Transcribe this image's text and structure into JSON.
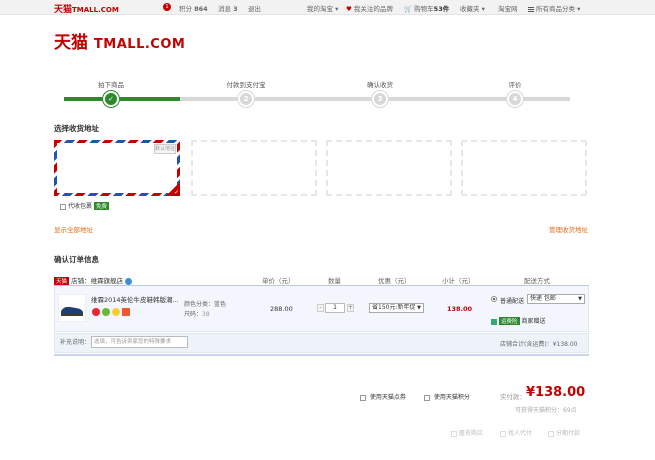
{
  "topbar": {
    "brand_cn": "天猫",
    "brand_en": "TMALL.COM",
    "notice_count": "1",
    "points_label": "积分",
    "points_value": "864",
    "messages_label": "消息",
    "messages_value": "3",
    "logout": "退出",
    "my_taobao": "我的淘宝",
    "followed_brands": "我关注的品牌",
    "cart_label": "购物车",
    "cart_count": "53件",
    "favorites": "收藏夹",
    "taobao_net": "淘宝网",
    "all_categories": "所有商品分类"
  },
  "logo": {
    "cn": "天猫",
    "en": "TMALL.COM"
  },
  "steps": [
    {
      "label": "拍下商品",
      "num": "✓",
      "done": true
    },
    {
      "label": "付款到支付宝",
      "num": "2",
      "done": false
    },
    {
      "label": "确认收货",
      "num": "3",
      "done": false
    },
    {
      "label": "评价",
      "num": "4",
      "done": false
    }
  ],
  "address": {
    "title": "选择收货地址",
    "stamp": "默认地址",
    "cod_label": "代收包裹",
    "cod_tag": "免费",
    "show_all": "显示全部地址",
    "manage": "管理收货地址"
  },
  "order": {
    "title": "确认订单信息",
    "shop_badge": "天猫",
    "shop_label": "店铺：",
    "shop_name": "维霖旗舰店",
    "col_price": "单价（元）",
    "col_qty": "数量",
    "col_discount": "优惠（元）",
    "col_subtotal": "小计（元）",
    "col_shipping": "配送方式",
    "item_title": "维霖2014英伦牛皮鞋韩版潮...",
    "attr_color": "颜色分类：蓝色",
    "attr_size_label": "尺码：",
    "attr_size_value": "38",
    "price": "288.00",
    "qty": "1",
    "discount_option": "省150元:新年促",
    "subtotal": "138.00",
    "ship_normal": "普通配送",
    "ship_option": "快递 包邮",
    "ship_tag": "运费险",
    "ship_merchant": "商家赠送",
    "remark_label": "补充说明：",
    "remark_placeholder": "选填，可告诉卖家您的特殊要求",
    "shop_total_label": "店铺合计(含运费)：",
    "shop_total_value": "¥138.00"
  },
  "summary": {
    "use_coupon": "使用天猫点券",
    "use_points": "使用天猫积分",
    "actual_label": "实付款：",
    "actual_value": "¥138.00",
    "earn_points_label": "可获得天猫积分：",
    "earn_points_value": "69点",
    "anonymous": "匿名购买",
    "proxy_pay": "找人代付",
    "installment": "分期付款"
  }
}
